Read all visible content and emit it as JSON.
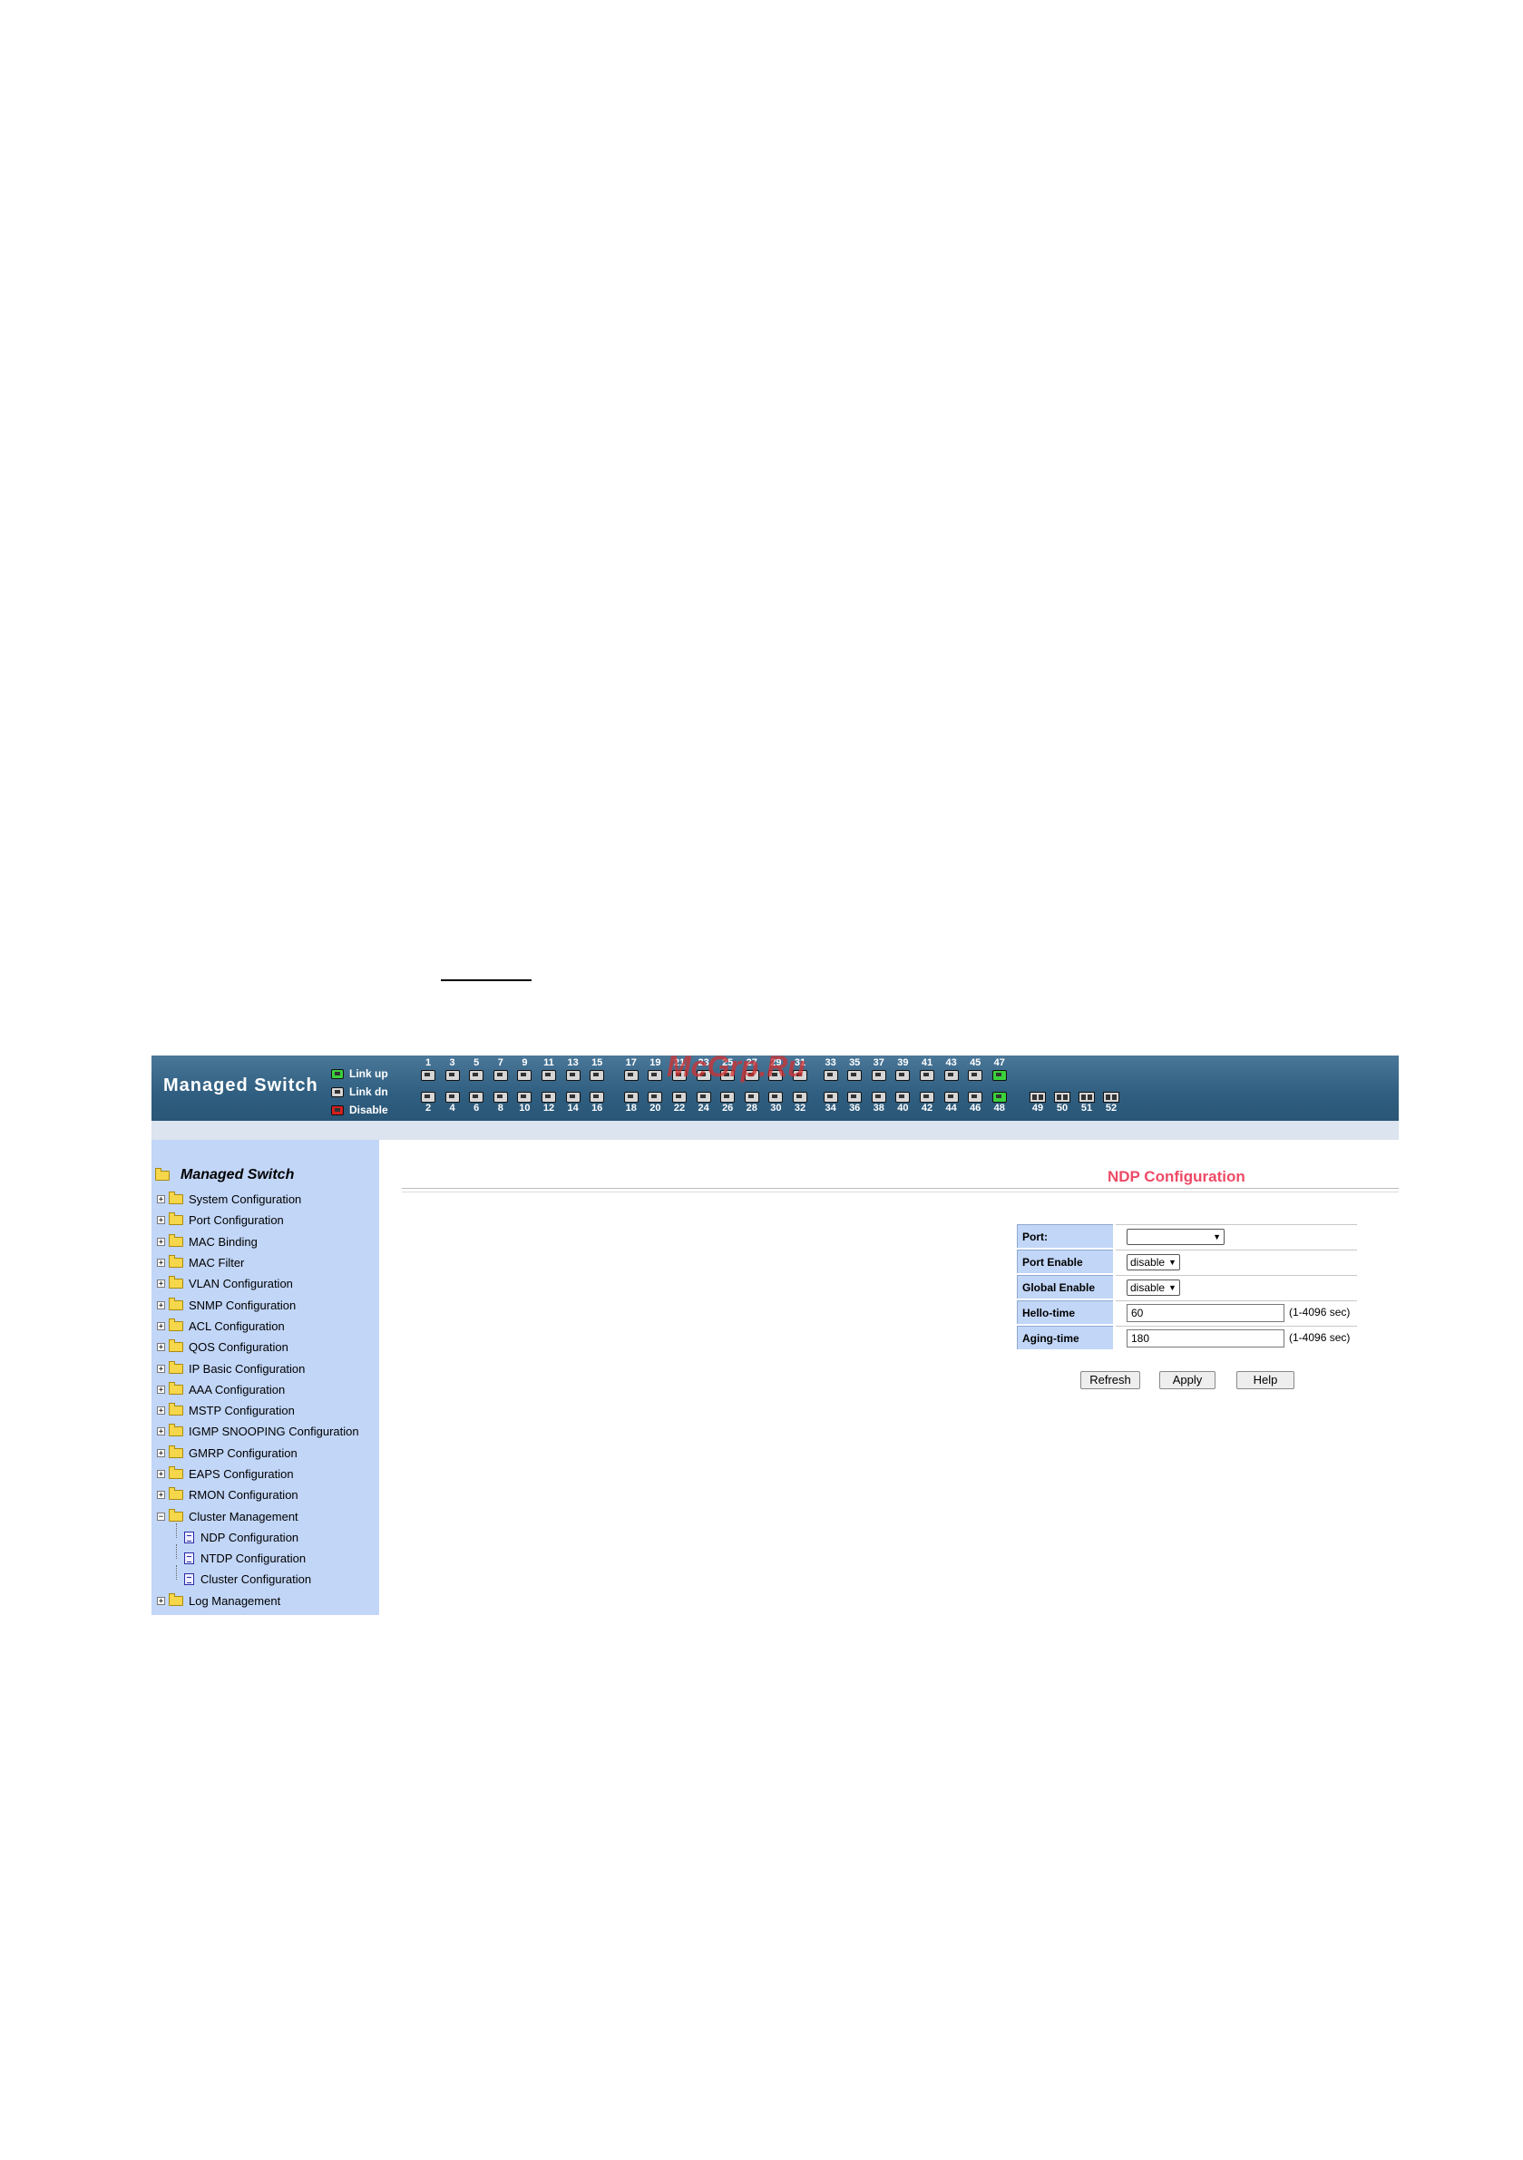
{
  "header": {
    "title": "Managed Switch",
    "legend": [
      {
        "label": "Link up",
        "state": "up"
      },
      {
        "label": "Link dn",
        "state": "dn"
      },
      {
        "label": "Disable",
        "state": "dis"
      }
    ],
    "ports_odd": [
      "1",
      "3",
      "5",
      "7",
      "9",
      "11",
      "13",
      "15",
      "17",
      "19",
      "21",
      "23",
      "25",
      "27",
      "29",
      "31",
      "33",
      "35",
      "37",
      "39",
      "41",
      "43",
      "45",
      "47"
    ],
    "ports_even": [
      "2",
      "4",
      "6",
      "8",
      "10",
      "12",
      "14",
      "16",
      "18",
      "20",
      "22",
      "24",
      "26",
      "28",
      "30",
      "32",
      "34",
      "36",
      "38",
      "40",
      "42",
      "44",
      "46",
      "48"
    ],
    "link_up_ports": [
      "47",
      "48"
    ],
    "sfp_ports": [
      "49",
      "50",
      "51",
      "52"
    ],
    "watermark": "McGrp.Ru"
  },
  "sidebar": {
    "root": "Managed Switch",
    "items": [
      {
        "label": "System Configuration",
        "expanded": false
      },
      {
        "label": "Port Configuration",
        "expanded": false
      },
      {
        "label": "MAC Binding",
        "expanded": false
      },
      {
        "label": "MAC Filter",
        "expanded": false
      },
      {
        "label": "VLAN Configuration",
        "expanded": false
      },
      {
        "label": "SNMP Configuration",
        "expanded": false
      },
      {
        "label": "ACL Configuration",
        "expanded": false
      },
      {
        "label": "QOS Configuration",
        "expanded": false
      },
      {
        "label": "IP Basic Configuration",
        "expanded": false
      },
      {
        "label": "AAA Configuration",
        "expanded": false
      },
      {
        "label": "MSTP Configuration",
        "expanded": false
      },
      {
        "label": "IGMP SNOOPING Configuration",
        "expanded": false
      },
      {
        "label": "GMRP Configuration",
        "expanded": false
      },
      {
        "label": "EAPS Configuration",
        "expanded": false
      },
      {
        "label": "RMON Configuration",
        "expanded": false
      },
      {
        "label": "Cluster Management",
        "expanded": true,
        "children": [
          "NDP Configuration",
          "NTDP Configuration",
          "Cluster Configuration"
        ]
      },
      {
        "label": "Log Management",
        "expanded": false
      }
    ]
  },
  "main": {
    "title": "NDP Configuration",
    "form": {
      "port_label": "Port:",
      "port_value": "",
      "port_enable_label": "Port Enable",
      "port_enable_value": "disable",
      "global_enable_label": "Global Enable",
      "global_enable_value": "disable",
      "hello_label": "Hello-time",
      "hello_value": "60",
      "hello_hint": "(1-4096 sec)",
      "aging_label": "Aging-time",
      "aging_value": "180",
      "aging_hint": "(1-4096 sec)"
    },
    "buttons": {
      "refresh": "Refresh",
      "apply": "Apply",
      "help": "Help"
    }
  },
  "colors": {
    "banner": "#2f5e80",
    "sidebar": "#c2d6f7",
    "title_accent": "#ee4a66",
    "link_up": "#3bd13b",
    "disable": "#d32020"
  }
}
